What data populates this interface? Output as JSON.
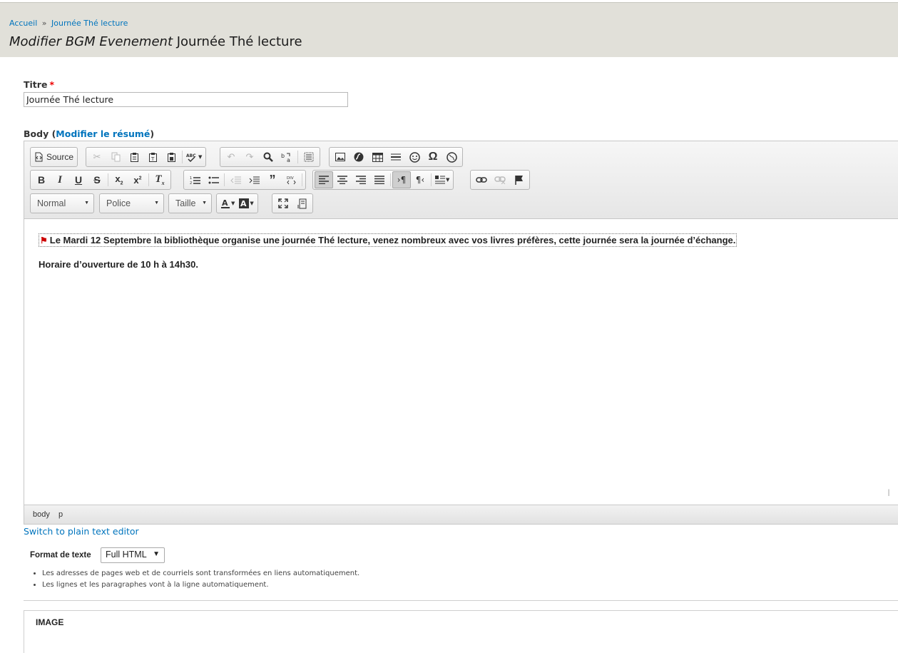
{
  "breadcrumb": {
    "home": "Accueil",
    "separator": "»",
    "current": "Journée Thé lecture"
  },
  "page_title": {
    "prefix": "Modifier BGM Evenement",
    "name": "Journée Thé lecture"
  },
  "title_field": {
    "label": "Titre",
    "required_mark": "*",
    "value": "Journée Thé lecture"
  },
  "body_field": {
    "label": "Body",
    "open_paren": "(",
    "summary_link": "Modifier le résumé",
    "close_paren": ")"
  },
  "toolbar": {
    "source_label": "Source",
    "format_combo": "Normal",
    "font_combo": "Police",
    "size_combo": "Taille",
    "bold": "B",
    "italic": "I",
    "underline": "U",
    "strike": "S"
  },
  "content": {
    "para1": "Le Mardi 12 Septembre la bibliothèque organise une journée Thé lecture, venez nombreux avec vos livres préfères, cette journée sera la journée d’échange.",
    "para2": "Horaire d’ouverture de 10 h à 14h30."
  },
  "statusbar": {
    "path1": "body",
    "path2": "p"
  },
  "switch_link": "Switch to plain text editor",
  "text_format": {
    "label": "Format de texte",
    "selected": "Full HTML",
    "tips": [
      "Les adresses de pages web et de courriels sont transformées en liens automatiquement.",
      "Les lignes et les paragraphes vont à la ligne automatiquement."
    ]
  },
  "image_section": {
    "title": "IMAGE"
  }
}
